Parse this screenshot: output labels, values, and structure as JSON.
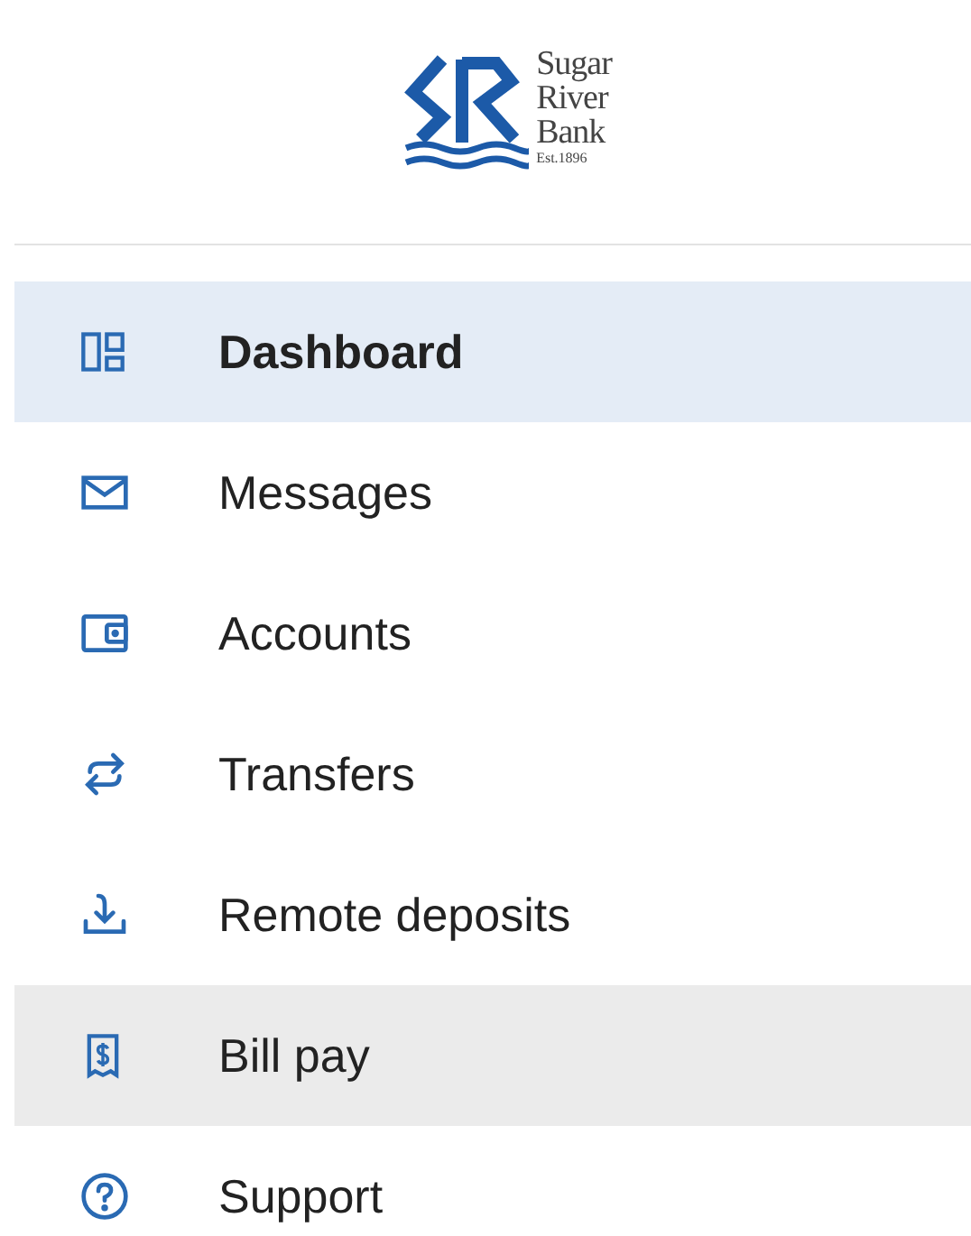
{
  "logo": {
    "name_lines": [
      "Sugar",
      "River",
      "Bank"
    ],
    "established": "Est.1896"
  },
  "nav": [
    {
      "kind": "dashboard",
      "label": "Dashboard",
      "selected": true,
      "hovered": false
    },
    {
      "kind": "messages",
      "label": "Messages",
      "selected": false,
      "hovered": false
    },
    {
      "kind": "accounts",
      "label": "Accounts",
      "selected": false,
      "hovered": false
    },
    {
      "kind": "transfers",
      "label": "Transfers",
      "selected": false,
      "hovered": false
    },
    {
      "kind": "deposits",
      "label": "Remote deposits",
      "selected": false,
      "hovered": false
    },
    {
      "kind": "billpay",
      "label": "Bill pay",
      "selected": false,
      "hovered": true
    },
    {
      "kind": "support",
      "label": "Support",
      "selected": false,
      "hovered": false
    }
  ]
}
